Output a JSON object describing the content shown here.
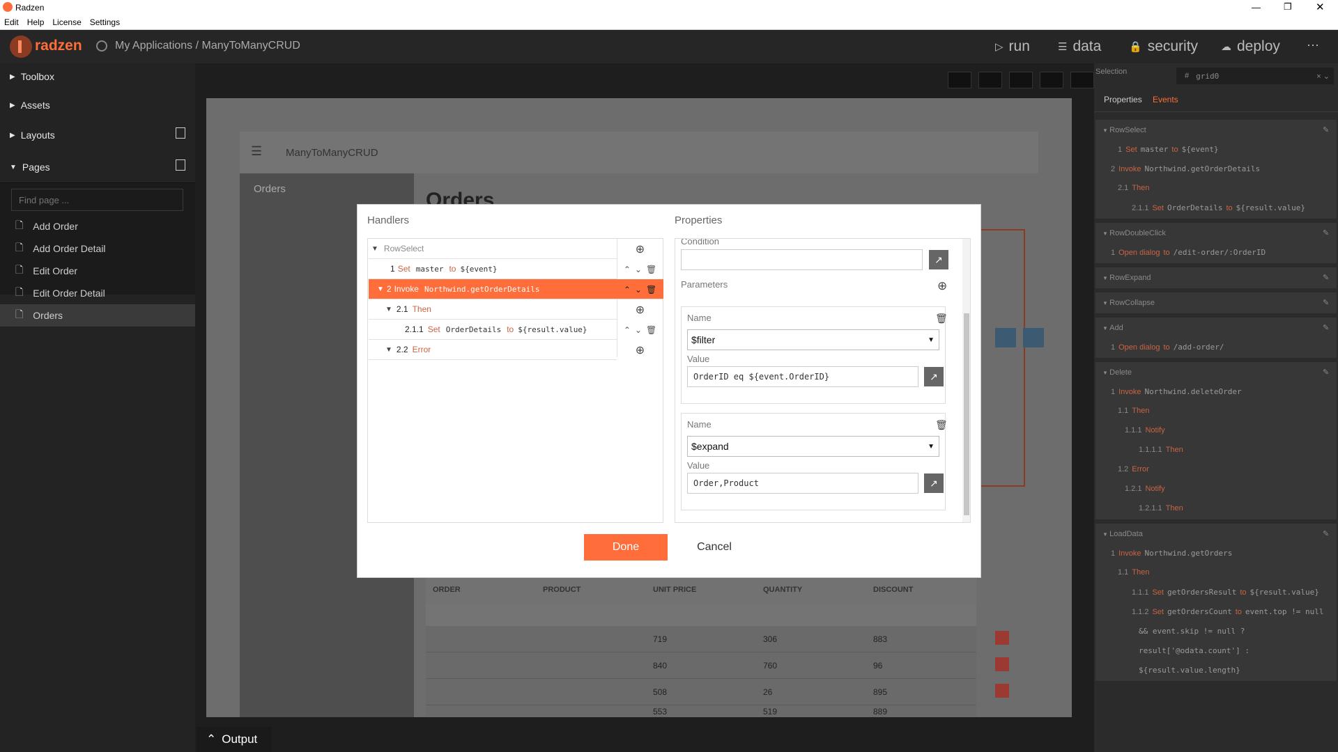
{
  "window": {
    "title": "Radzen",
    "menu": [
      "Edit",
      "Help",
      "License",
      "Settings"
    ]
  },
  "header": {
    "logo": "radzen",
    "breadcrumb": "My Applications / ManyToManyCRUD",
    "nav": [
      {
        "label": "run",
        "icon": "play-icon"
      },
      {
        "label": "data",
        "icon": "layers-icon"
      },
      {
        "label": "security",
        "icon": "lock-icon"
      },
      {
        "label": "deploy",
        "icon": "cloud-upload-icon"
      }
    ]
  },
  "sidebar": {
    "sections": {
      "toolbox": "Toolbox",
      "assets": "Assets",
      "layouts": "Layouts",
      "pages": "Pages"
    },
    "search_placeholder": "Find page ...",
    "pages": [
      "Add Order",
      "Add Order Detail",
      "Edit Order",
      "Edit Order Detail",
      "Orders"
    ],
    "selected": "Orders"
  },
  "canvas": {
    "app_title": "ManyToManyCRUD",
    "nav_item": "Orders",
    "heading": "Orders",
    "grid": {
      "columns": [
        "ORDER",
        "PRODUCT",
        "UNIT PRICE",
        "QUANTITY",
        "DISCOUNT"
      ],
      "rows": [
        [
          "",
          "",
          "719",
          "306",
          "883"
        ],
        [
          "",
          "",
          "840",
          "760",
          "96"
        ],
        [
          "",
          "",
          "508",
          "26",
          "895"
        ],
        [
          "",
          "",
          "553",
          "519",
          "889"
        ]
      ]
    }
  },
  "output": {
    "label": "Output"
  },
  "right": {
    "selection_label": "Selection",
    "selection_value": "grid0",
    "tabs": [
      "Properties",
      "Events"
    ],
    "active_tab": "Events",
    "events": [
      {
        "name": "RowSelect",
        "lines": [
          {
            "num": "1",
            "kw": "Set",
            "text": "master",
            "kw2": "to",
            "val": "${event}"
          },
          {
            "num": "2",
            "kw": "Invoke",
            "text": "Northwind.getOrderDetails"
          },
          {
            "num": "2.1",
            "kw": "Then"
          },
          {
            "num": "2.1.1",
            "kw": "Set",
            "text": "OrderDetails",
            "kw2": "to",
            "val": "${result.value}"
          }
        ]
      },
      {
        "name": "RowDoubleClick",
        "lines": [
          {
            "num": "1",
            "kw": "Open dialog",
            "kw2": "to",
            "val": "/edit-order/:OrderID"
          }
        ]
      },
      {
        "name": "RowExpand",
        "lines": []
      },
      {
        "name": "RowCollapse",
        "lines": []
      },
      {
        "name": "Add",
        "lines": [
          {
            "num": "1",
            "kw": "Open dialog",
            "kw2": "to",
            "val": "/add-order/"
          }
        ]
      },
      {
        "name": "Delete",
        "lines": [
          {
            "num": "1",
            "kw": "Invoke",
            "text": "Northwind.deleteOrder"
          },
          {
            "num": "1.1",
            "kw": "Then"
          },
          {
            "num": "1.1.1",
            "kw": "Notify"
          },
          {
            "num": "1.1.1.1",
            "kw": "Then"
          },
          {
            "num": "1.2",
            "kw": "Error"
          },
          {
            "num": "1.2.1",
            "kw": "Notify"
          },
          {
            "num": "1.2.1.1",
            "kw": "Then"
          }
        ]
      },
      {
        "name": "LoadData",
        "lines": [
          {
            "num": "1",
            "kw": "Invoke",
            "text": "Northwind.getOrders"
          },
          {
            "num": "1.1",
            "kw": "Then"
          },
          {
            "num": "1.1.1",
            "kw": "Set",
            "text": "getOrdersResult",
            "kw2": "to",
            "val": "${result.value}"
          },
          {
            "num": "1.1.2",
            "kw": "Set",
            "text": "getOrdersCount",
            "kw2": "to",
            "val": "event.top != null"
          },
          {
            "val": "&& event.skip != null ?"
          },
          {
            "val": "result['@odata.count'] :"
          },
          {
            "val": "${result.value.length}"
          }
        ]
      }
    ]
  },
  "dialog": {
    "handlers_title": "Handlers",
    "properties_title": "Properties",
    "handlers": [
      {
        "num": "",
        "label": "RowSelect"
      },
      {
        "num": "1",
        "kw": "Set",
        "text": "master",
        "kw2": "to",
        "val": "${event}"
      },
      {
        "num": "2",
        "kw": "Invoke",
        "text": "Northwind.getOrderDetails"
      },
      {
        "num": "2.1",
        "kw": "Then"
      },
      {
        "num": "2.1.1",
        "kw": "Set",
        "text": "OrderDetails",
        "kw2": "to",
        "val": "${result.value}"
      },
      {
        "num": "2.2",
        "kw": "Error"
      }
    ],
    "condition_label": "Condition",
    "condition_value": "",
    "parameters_label": "Parameters",
    "params": [
      {
        "name_label": "Name",
        "name": "$filter",
        "value_label": "Value",
        "value": "OrderID eq ${event.OrderID}"
      },
      {
        "name_label": "Name",
        "name": "$expand",
        "value_label": "Value",
        "value": "Order,Product"
      }
    ],
    "done": "Done",
    "cancel": "Cancel"
  },
  "colors": {
    "accent": "#ff6d3a",
    "dark": "#262626",
    "panel": "#2b2b2b"
  }
}
